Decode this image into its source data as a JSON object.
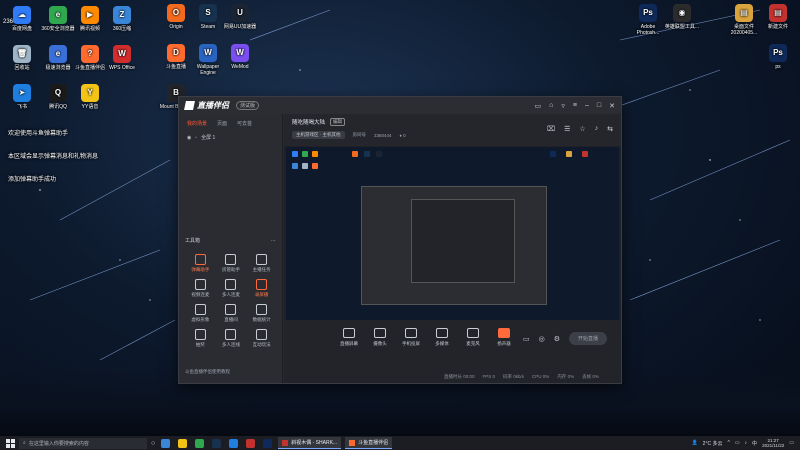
{
  "desktop": {
    "corner_id": "2360444",
    "icons_left": [
      {
        "label": "百度网盘",
        "color": "#2f7cf6",
        "glyph": "☁",
        "icon": "cloud-icon"
      },
      {
        "label": "360安全浏览器",
        "color": "#2fa84f",
        "glyph": "e",
        "icon": "browser-icon"
      },
      {
        "label": "腾讯视频",
        "color": "#ff8a00",
        "glyph": "▶",
        "icon": "play-icon"
      },
      {
        "label": "360压缩",
        "color": "#3a86d8",
        "glyph": "Z",
        "icon": "archive-icon"
      },
      {
        "label": "回收站",
        "color": "#9fb4c7",
        "glyph": "🗑",
        "icon": "recycle-bin-icon"
      },
      {
        "label": "极速浏览器",
        "color": "#3b6fd8",
        "glyph": "e",
        "icon": "browser-icon"
      },
      {
        "label": "斗鱼直播伴侣",
        "color": "#ff6a2e",
        "glyph": "?",
        "icon": "douyu-icon"
      },
      {
        "label": "WPS Office",
        "color": "#d12d2d",
        "glyph": "W",
        "icon": "wps-icon"
      },
      {
        "label": "飞书",
        "color": "#1f7fe0",
        "glyph": "➤",
        "icon": "feishu-icon"
      },
      {
        "label": "腾讯QQ",
        "color": "#1a1a1a",
        "glyph": "Q",
        "icon": "qq-icon"
      },
      {
        "label": "YY语音",
        "color": "#f3c316",
        "glyph": "Y",
        "icon": "yy-icon"
      }
    ],
    "icons_mid": [
      {
        "label": "Origin",
        "color": "#f36a1e",
        "glyph": "O",
        "icon": "origin-icon"
      },
      {
        "label": "Steam",
        "color": "#16324f",
        "glyph": "S",
        "icon": "steam-icon"
      },
      {
        "label": "网易UU加速器",
        "color": "#1b2433",
        "glyph": "U",
        "icon": "uu-icon"
      },
      {
        "label": "斗鱼直播",
        "color": "#ff6a2e",
        "glyph": "D",
        "icon": "douyu-icon"
      },
      {
        "label": "Wallpaper Engine",
        "color": "#2a64c2",
        "glyph": "W",
        "icon": "wallpaper-engine-icon"
      },
      {
        "label": "WeMod",
        "color": "#7a4ff0",
        "glyph": "W",
        "icon": "wemod-icon"
      },
      {
        "label": "Mount Blade II",
        "color": "#22252b",
        "glyph": "B",
        "icon": "game-icon"
      }
    ],
    "icons_right": [
      {
        "label": "Adobe Photosh...",
        "color": "#0f2a5a",
        "glyph": "Ps",
        "icon": "photoshop-icon"
      },
      {
        "label": "英雄联盟工具...",
        "color": "#2b2b2b",
        "glyph": "◉",
        "icon": "lol-icon"
      },
      {
        "label": "桌面文件20200405...",
        "color": "#d9a33e",
        "glyph": "▤",
        "icon": "folder-icon"
      },
      {
        "label": "新建文件",
        "color": "#c4322f",
        "glyph": "▤",
        "icon": "folder-icon"
      },
      {
        "label": "ps",
        "color": "#0f2a5a",
        "glyph": "Ps",
        "icon": "photoshop-icon"
      }
    ],
    "overlay_messages": [
      "欢迎使用斗鱼弹幕助手",
      "本区域会显示弹幕消息和礼物消息",
      "添加弹幕助手成功"
    ]
  },
  "app": {
    "logo_text": "直播伴侣",
    "version_badge": "测试版",
    "sidebar": {
      "tabs": [
        "我的场景",
        "页面",
        "可去首"
      ],
      "active_tab": 0,
      "scene": "全屏 1",
      "tools_label": "工具箱",
      "tools": [
        {
          "label": "弹幕助手",
          "hot": true
        },
        {
          "label": "房管助手",
          "hot": false
        },
        {
          "label": "主播任务",
          "hot": false
        },
        {
          "label": "视频连麦",
          "hot": false
        },
        {
          "label": "多人连麦",
          "hot": false
        },
        {
          "label": "录屏播",
          "hot": true
        },
        {
          "label": "虚拟形象",
          "hot": false
        },
        {
          "label": "直播间",
          "hot": false
        },
        {
          "label": "数据统计",
          "hot": false
        },
        {
          "label": "抽奖",
          "hot": false
        },
        {
          "label": "多人连线",
          "hot": false
        },
        {
          "label": "互动玩法",
          "hot": false
        }
      ],
      "bottom_note": "斗鱼直播伴侣使用教程"
    },
    "room": {
      "title": "随吃随喝大陆",
      "edit_label": "编辑",
      "category": "主机游戏区 · 主机其他",
      "room_prefix": "房间号",
      "room_id": "2360444",
      "fans": "0"
    },
    "toolbar": {
      "items": [
        {
          "label": "直播屏幕",
          "icon": "screen-icon",
          "orange": false
        },
        {
          "label": "摄像头",
          "icon": "camera-icon",
          "orange": false
        },
        {
          "label": "手机投屏",
          "icon": "phone-cast-icon",
          "orange": false
        },
        {
          "label": "多媒体",
          "icon": "media-icon",
          "orange": false
        },
        {
          "label": "麦克风",
          "icon": "microphone-icon",
          "orange": false
        },
        {
          "label": "扬声器",
          "icon": "speaker-icon",
          "orange": true
        }
      ],
      "start_label": "开始直播",
      "status": [
        "直播时长 00:00",
        "FPS 0",
        "码率 0kb/s",
        "CPU 0%",
        "内存 0%",
        "丢帧 0%"
      ]
    }
  },
  "taskbar": {
    "search_placeholder": "在这里输入你要搜索的内容",
    "tasks": [
      {
        "label": "斜视木偶 - SHARK...",
        "color": "#c4322f"
      },
      {
        "label": "斗鱼直播伴侣",
        "color": "#ff6a2e"
      }
    ],
    "weather": "2°C 多云",
    "ime": "中",
    "time": "21:27",
    "date": "2021/11/22"
  }
}
